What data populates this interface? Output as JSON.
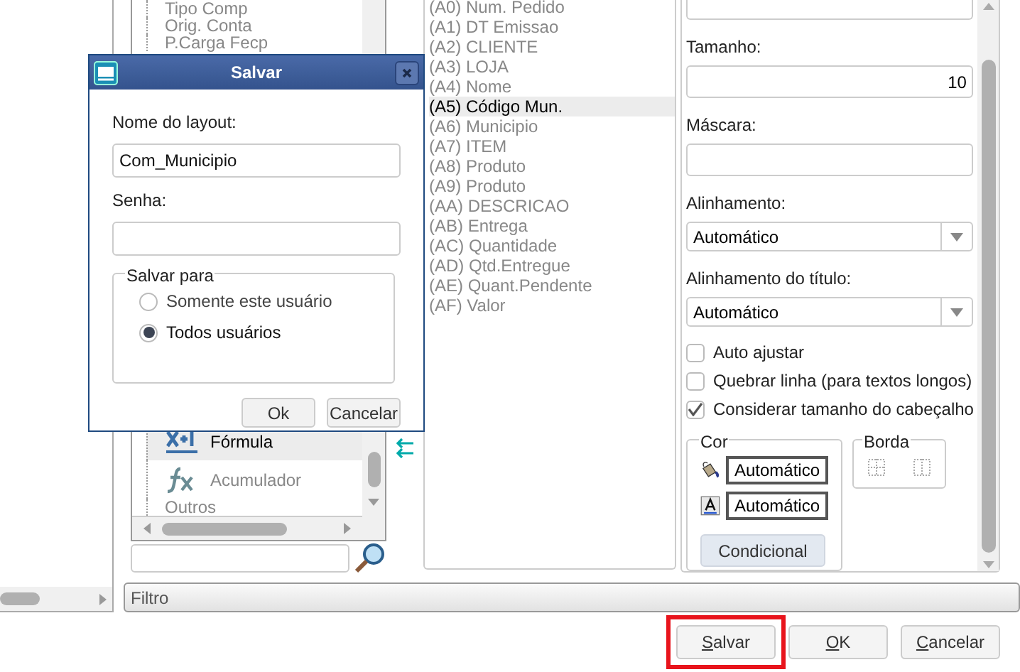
{
  "tree": {
    "items": [
      {
        "label": "Tipo Comp",
        "kind": "text",
        "selected": false
      },
      {
        "label": "Orig. Conta",
        "kind": "text",
        "selected": false
      },
      {
        "label": "P.Carga Fecp",
        "kind": "text",
        "selected": false
      },
      {
        "label": "Fórmula",
        "kind": "formula",
        "selected": true
      },
      {
        "label": "Acumulador",
        "kind": "accumulator",
        "selected": false
      },
      {
        "label": "Outros",
        "kind": "group",
        "selected": false
      }
    ]
  },
  "columns": [
    {
      "label": "(A0) Num. Pedido",
      "selected": false
    },
    {
      "label": "(A1) DT Emissao",
      "selected": false
    },
    {
      "label": "(A2) CLIENTE",
      "selected": false
    },
    {
      "label": "(A3) LOJA",
      "selected": false
    },
    {
      "label": "(A4) Nome",
      "selected": false
    },
    {
      "label": "(A5) Código Mun.",
      "selected": true
    },
    {
      "label": "(A6) Municipio",
      "selected": false
    },
    {
      "label": "(A7) ITEM",
      "selected": false
    },
    {
      "label": "(A8) Produto",
      "selected": false
    },
    {
      "label": "(A9) Produto",
      "selected": false
    },
    {
      "label": "(AA) DESCRICAO",
      "selected": false
    },
    {
      "label": "(AB) Entrega",
      "selected": false
    },
    {
      "label": "(AC) Quantidade",
      "selected": false
    },
    {
      "label": "(AD) Qtd.Entregue",
      "selected": false
    },
    {
      "label": "(AE) Quant.Pendente",
      "selected": false
    },
    {
      "label": "(AF) Valor",
      "selected": false
    }
  ],
  "properties": {
    "fields": [
      {
        "kind": "input",
        "label": "Tamanho:",
        "value": "10"
      },
      {
        "kind": "input",
        "label": "Máscara:"
      },
      {
        "kind": "select",
        "label": "Alinhamento:",
        "value": "Automático"
      },
      {
        "kind": "select",
        "label": "Alinhamento do título:",
        "value": "Automático"
      }
    ],
    "checkboxes": [
      {
        "label": "Auto ajustar",
        "checked": false
      },
      {
        "label": "Quebrar linha (para textos longos)",
        "checked": false
      },
      {
        "label": "Considerar tamanho do cabeçalho",
        "checked": true
      }
    ],
    "color": {
      "title": "Cor",
      "fill": "Automático",
      "text": "Automático",
      "button": "Condicional"
    },
    "border": {
      "title": "Borda"
    }
  },
  "filter": {
    "label": "Filtro"
  },
  "buttons": [
    {
      "label": "Salvar",
      "highlighted": true
    },
    {
      "label": "OK",
      "highlighted": false
    },
    {
      "label": "Cancelar",
      "highlighted": false
    }
  ],
  "dialog": {
    "title": "Salvar",
    "name_label": "Nome do layout:",
    "name_value": "Com_Municipio",
    "password_label": "Senha:",
    "group_title": "Salvar para",
    "options": [
      {
        "label": "Somente este usuário",
        "selected": false
      },
      {
        "label": "Todos usuários",
        "selected": true
      }
    ],
    "buttons": [
      "Ok",
      "Cancelar"
    ]
  }
}
